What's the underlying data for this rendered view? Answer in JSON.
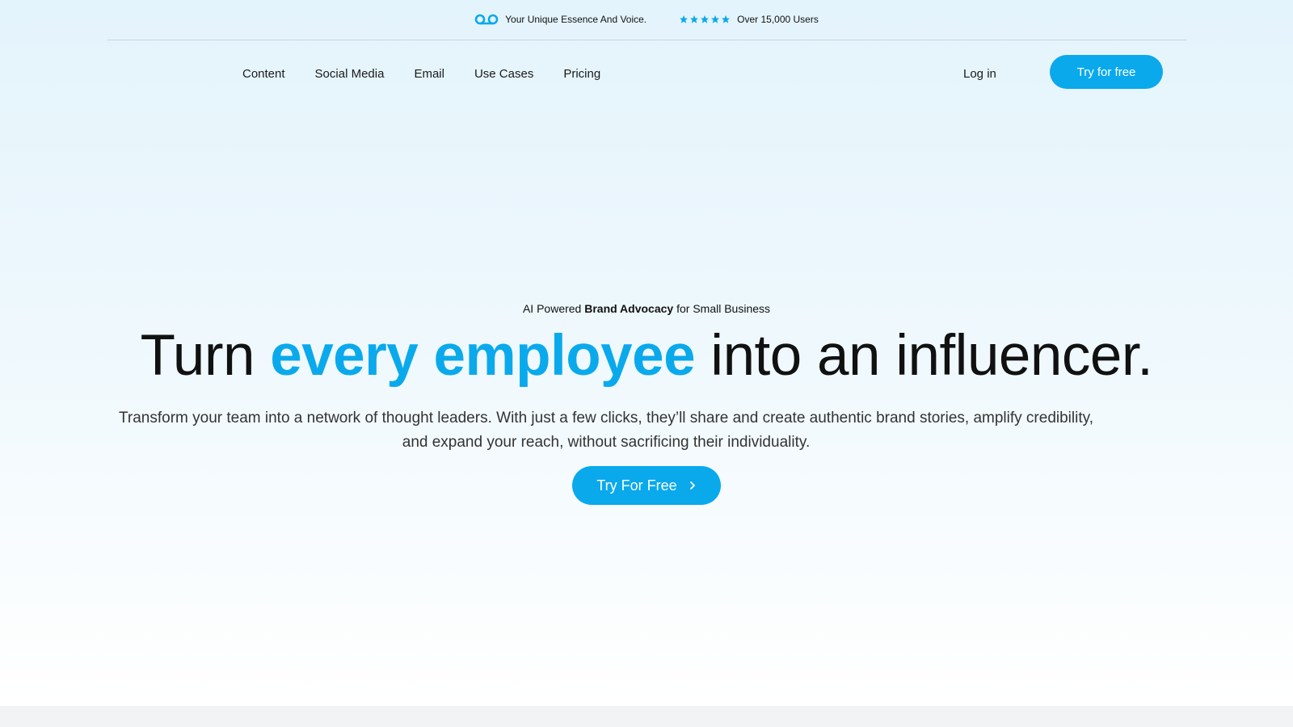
{
  "announcement": {
    "essence_text": "Your Unique Essence And Voice.",
    "users_text": "Over 15,000 Users",
    "rating_stars": 5,
    "icons": [
      "voicemail-icon",
      "star-icon"
    ]
  },
  "nav": {
    "links": [
      "Content",
      "Social Media",
      "Email",
      "Use Cases",
      "Pricing"
    ],
    "login_label": "Log in",
    "cta_label": "Try for free"
  },
  "hero": {
    "eyebrow_prefix": "AI Powered ",
    "eyebrow_bold": "Brand Advocacy",
    "eyebrow_suffix": " for Small Business",
    "headline_start": "Turn ",
    "headline_highlight": "every employee",
    "headline_end": " into an influencer.",
    "subtext": "Transform your team into a network of thought leaders. With just a few clicks, they’ll share and create authentic brand stories, amplify credibility, and expand your reach, without sacrificing their individuality.",
    "cta_label": "Try For Free",
    "cta_icon": "chevron-right-icon"
  },
  "colors": {
    "accent": "#0aa9ec",
    "text": "#111111",
    "bottom_band": "#f2f3f4"
  }
}
